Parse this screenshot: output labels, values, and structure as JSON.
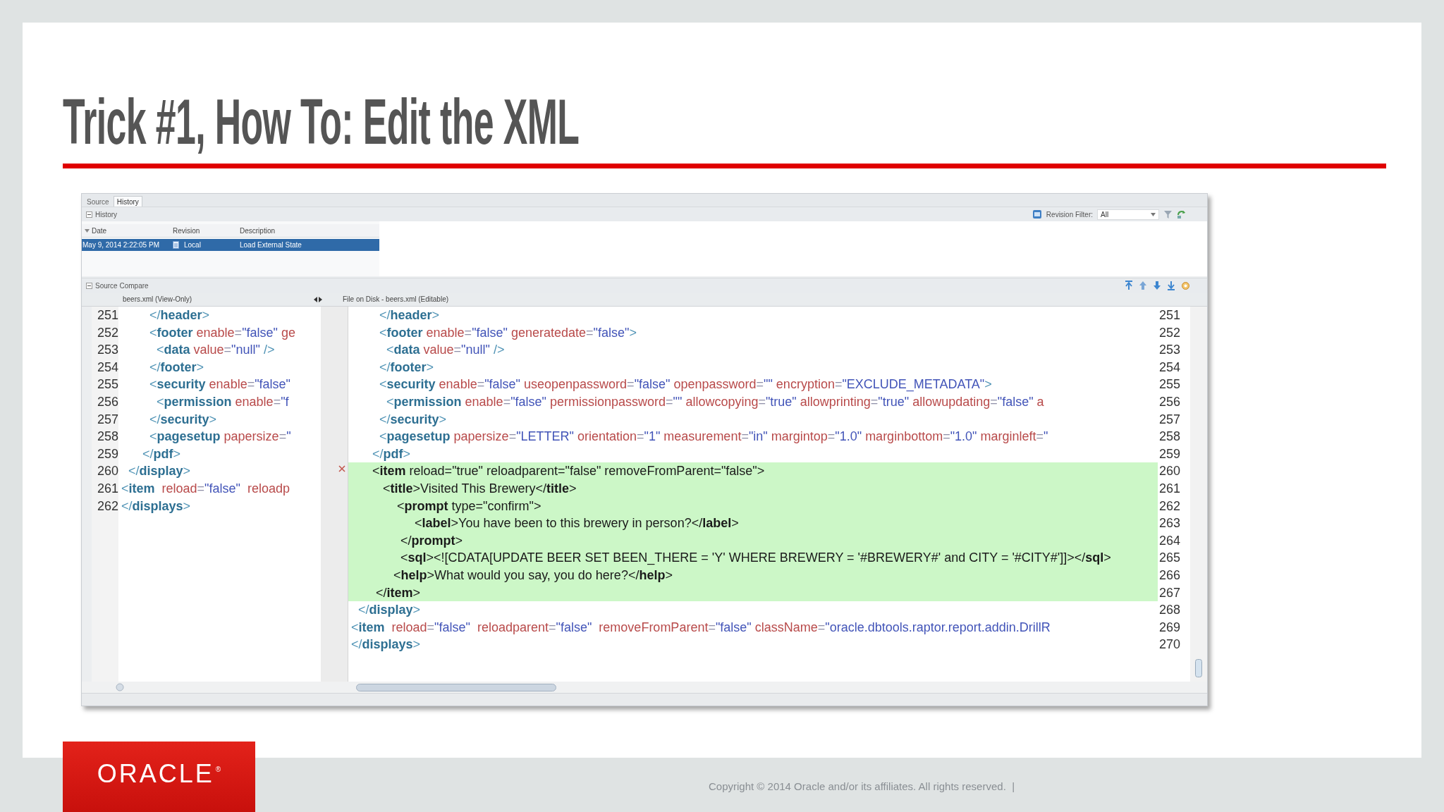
{
  "slide": {
    "title": "Trick #1, How To: Edit the XML"
  },
  "window": {
    "tabs": [
      {
        "label": "Source",
        "selected": false
      },
      {
        "label": "History",
        "selected": true
      }
    ],
    "history": {
      "title": "History",
      "revision_filter_label": "Revision Filter:",
      "revision_filter": "All",
      "columns": [
        "Date",
        "Revision",
        "Description"
      ],
      "rows": [
        {
          "date": "May 9, 2014 2:22:05 PM",
          "revision": "Local",
          "description": "Load External State",
          "selected": true
        }
      ]
    },
    "compare": {
      "title": "Source Compare",
      "left": {
        "title": "beers.xml (View-Only)",
        "lines": [
          {
            "number": "251",
            "text": "        </header>"
          },
          {
            "number": "252",
            "text": "        <footer enable=\"false\" ge"
          },
          {
            "number": "253",
            "text": "          <data value=\"null\" />"
          },
          {
            "number": "254",
            "text": "        </footer>"
          },
          {
            "number": "255",
            "text": "        <security enable=\"false\""
          },
          {
            "number": "256",
            "text": "          <permission enable=\"f"
          },
          {
            "number": "257",
            "text": "        </security>"
          },
          {
            "number": "258",
            "text": "        <pagesetup papersize=\""
          },
          {
            "number": "259",
            "text": "      </pdf>"
          },
          {
            "number": "260",
            "text": "  </display>"
          },
          {
            "number": "261",
            "text": "<item  reload=\"false\"  reloadp"
          },
          {
            "number": "262",
            "text": "</displays>"
          }
        ]
      },
      "right": {
        "title": "File on Disk - beers.xml (Editable)",
        "lines": [
          {
            "number": "251",
            "text": "        </header>",
            "changed": false
          },
          {
            "number": "252",
            "text": "        <footer enable=\"false\" generatedate=\"false\">",
            "changed": false
          },
          {
            "number": "253",
            "text": "          <data value=\"null\" />",
            "changed": false
          },
          {
            "number": "254",
            "text": "        </footer>",
            "changed": false
          },
          {
            "number": "255",
            "text": "        <security enable=\"false\" useopenpassword=\"false\" openpassword=\"\" encryption=\"EXCLUDE_METADATA\">",
            "changed": false
          },
          {
            "number": "256",
            "text": "          <permission enable=\"false\" permissionpassword=\"\" allowcopying=\"true\" allowprinting=\"true\" allowupdating=\"false\" a",
            "changed": false
          },
          {
            "number": "257",
            "text": "        </security>",
            "changed": false
          },
          {
            "number": "258",
            "text": "        <pagesetup papersize=\"LETTER\" orientation=\"1\" measurement=\"in\" margintop=\"1.0\" marginbottom=\"1.0\" marginleft=\"",
            "changed": false
          },
          {
            "number": "259",
            "text": "      </pdf>",
            "changed": false
          },
          {
            "number": "260",
            "text": "      <item reload=\"true\" reloadparent=\"false\" removeFromParent=\"false\">",
            "changed": true
          },
          {
            "number": "261",
            "text": "         <title>Visited This Brewery</title>",
            "changed": true
          },
          {
            "number": "262",
            "text": "             <prompt type=\"confirm\">",
            "changed": true
          },
          {
            "number": "263",
            "text": "                  <label>You have been to this brewery in person?</label>",
            "changed": true
          },
          {
            "number": "264",
            "text": "              </prompt>",
            "changed": true
          },
          {
            "number": "265",
            "text": "              <sql><![CDATA[UPDATE BEER SET BEEN_THERE = 'Y' WHERE BREWERY = '#BREWERY#' and CITY = '#CITY#']]></sql>",
            "changed": true
          },
          {
            "number": "266",
            "text": "            <help>What would you say, you do here?</help>",
            "changed": true
          },
          {
            "number": "267",
            "text": "       </item>",
            "changed": true
          },
          {
            "number": "268",
            "text": "  </display>",
            "changed": false
          },
          {
            "number": "269",
            "text": "<item  reload=\"false\"  reloadparent=\"false\"  removeFromParent=\"false\" className=\"oracle.dbtools.raptor.report.addin.DrillR",
            "changed": false
          },
          {
            "number": "270",
            "text": "</displays>",
            "changed": false
          }
        ]
      }
    }
  },
  "footer": {
    "logo": "ORACLE",
    "logo_mark": "®",
    "copyright": "Copyright © 2014 Oracle and/or its affiliates. All rights reserved.  |"
  }
}
